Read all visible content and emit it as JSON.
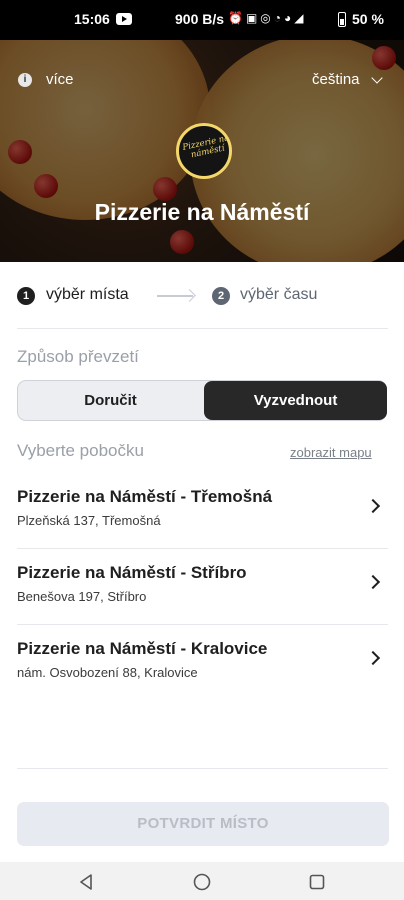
{
  "status_bar": {
    "time": "15:06",
    "network_speed": "900 B/s",
    "battery": "50 %"
  },
  "header": {
    "info_label": "více",
    "language": "čeština",
    "logo_text": "Pizzerie na náměstí",
    "title": "Pizzerie na Náměstí"
  },
  "steps": [
    {
      "number": "1",
      "label": "výběr místa",
      "active": true
    },
    {
      "number": "2",
      "label": "výběr času",
      "active": false
    }
  ],
  "pickup": {
    "label": "Způsob převzetí",
    "options": [
      "Doručit",
      "Vyzvednout"
    ],
    "selected": "Vyzvednout"
  },
  "branches_section": {
    "label": "Vyberte pobočku",
    "map_link": "zobrazit mapu"
  },
  "branches": [
    {
      "name": "Pizzerie na Náměstí - Třemošná",
      "address": "Plzeňská 137, Třemošná"
    },
    {
      "name": "Pizzerie na Náměstí - Stříbro",
      "address": "Benešova 197, Stříbro"
    },
    {
      "name": "Pizzerie na Náměstí - Kralovice",
      "address": "nám. Osvobození 88, Kralovice"
    }
  ],
  "confirm_button": "POTVRDIT MÍSTO",
  "colors": {
    "selected_segment": "#282828",
    "disabled_button": "#e7eaf0",
    "muted_text": "#9aa0a8"
  }
}
